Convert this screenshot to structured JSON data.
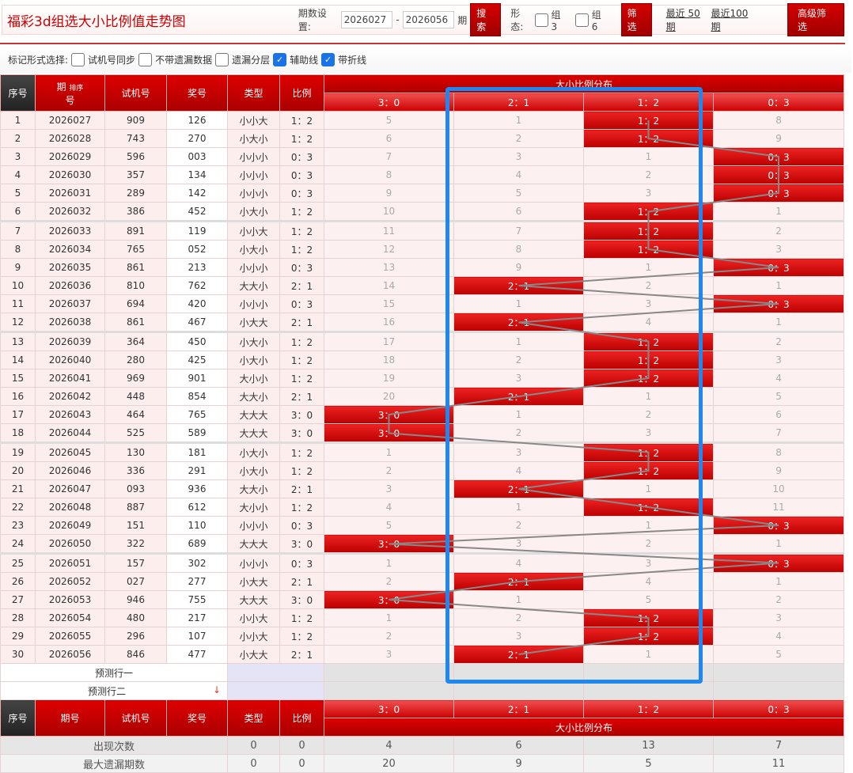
{
  "header": {
    "title": "福彩3d组选大小比例值走势图",
    "period_label": "期数设置:",
    "start": "2026027",
    "dash": "-",
    "end": "2026056",
    "period_suffix": "期",
    "search": "搜索",
    "form_label": "形态:",
    "group3": "组3",
    "group6": "组6",
    "filter": "筛选",
    "recent50": "最近 50期",
    "recent100": "最近100期",
    "advanced": "高级筛选"
  },
  "marks": {
    "label": "标记形式选择:",
    "options": [
      {
        "label": "试机号同步",
        "checked": false
      },
      {
        "label": "不带遗漏数据",
        "checked": false
      },
      {
        "label": "遗漏分层",
        "checked": false
      },
      {
        "label": "辅助线",
        "checked": true
      },
      {
        "label": "带折线",
        "checked": true
      }
    ]
  },
  "columns": {
    "seq": "序号",
    "period": "期号",
    "period_a": "期",
    "period_b": "号",
    "sort": "排序",
    "trial": "试机号",
    "draw": "奖号",
    "type": "类型",
    "ratio": "比例",
    "dist": "大小比例分布",
    "ratios": [
      "3：0",
      "2：1",
      "1：2",
      "0：3"
    ]
  },
  "rows": [
    [
      "1",
      "2026027",
      "909",
      "126",
      "小小大",
      "1：2",
      [
        5,
        1,
        "H",
        8
      ]
    ],
    [
      "2",
      "2026028",
      "743",
      "270",
      "小大小",
      "1：2",
      [
        6,
        2,
        "H",
        9
      ]
    ],
    [
      "3",
      "2026029",
      "596",
      "003",
      "小小小",
      "0：3",
      [
        7,
        3,
        1,
        "H"
      ]
    ],
    [
      "4",
      "2026030",
      "357",
      "134",
      "小小小",
      "0：3",
      [
        8,
        4,
        2,
        "H"
      ]
    ],
    [
      "5",
      "2026031",
      "289",
      "142",
      "小小小",
      "0：3",
      [
        9,
        5,
        3,
        "H"
      ]
    ],
    [
      "6",
      "2026032",
      "386",
      "452",
      "小大小",
      "1：2",
      [
        10,
        6,
        "H",
        1
      ]
    ],
    [
      "7",
      "2026033",
      "891",
      "119",
      "小小大",
      "1：2",
      [
        11,
        7,
        "H",
        2
      ]
    ],
    [
      "8",
      "2026034",
      "765",
      "052",
      "小大小",
      "1：2",
      [
        12,
        8,
        "H",
        3
      ]
    ],
    [
      "9",
      "2026035",
      "861",
      "213",
      "小小小",
      "0：3",
      [
        13,
        9,
        1,
        "H"
      ]
    ],
    [
      "10",
      "2026036",
      "810",
      "762",
      "大大小",
      "2：1",
      [
        14,
        "H",
        2,
        1
      ]
    ],
    [
      "11",
      "2026037",
      "694",
      "420",
      "小小小",
      "0：3",
      [
        15,
        1,
        3,
        "H"
      ]
    ],
    [
      "12",
      "2026038",
      "861",
      "467",
      "小大大",
      "2：1",
      [
        16,
        "H",
        4,
        1
      ]
    ],
    [
      "13",
      "2026039",
      "364",
      "450",
      "小大小",
      "1：2",
      [
        17,
        1,
        "H",
        2
      ]
    ],
    [
      "14",
      "2026040",
      "280",
      "425",
      "小大小",
      "1：2",
      [
        18,
        2,
        "H",
        3
      ]
    ],
    [
      "15",
      "2026041",
      "969",
      "901",
      "大小小",
      "1：2",
      [
        19,
        3,
        "H",
        4
      ]
    ],
    [
      "16",
      "2026042",
      "448",
      "854",
      "大大小",
      "2：1",
      [
        20,
        "H",
        1,
        5
      ]
    ],
    [
      "17",
      "2026043",
      "464",
      "765",
      "大大大",
      "3：0",
      [
        "H",
        1,
        2,
        6
      ]
    ],
    [
      "18",
      "2026044",
      "525",
      "589",
      "大大大",
      "3：0",
      [
        "H",
        2,
        3,
        7
      ]
    ],
    [
      "19",
      "2026045",
      "130",
      "181",
      "小大小",
      "1：2",
      [
        1,
        3,
        "H",
        8
      ]
    ],
    [
      "20",
      "2026046",
      "336",
      "291",
      "小大小",
      "1：2",
      [
        2,
        4,
        "H",
        9
      ]
    ],
    [
      "21",
      "2026047",
      "093",
      "936",
      "大大小",
      "2：1",
      [
        3,
        "H",
        1,
        10
      ]
    ],
    [
      "22",
      "2026048",
      "887",
      "612",
      "大小小",
      "1：2",
      [
        4,
        1,
        "H",
        11
      ]
    ],
    [
      "23",
      "2026049",
      "151",
      "110",
      "小小小",
      "0：3",
      [
        5,
        2,
        1,
        "H"
      ]
    ],
    [
      "24",
      "2026050",
      "322",
      "689",
      "大大大",
      "3：0",
      [
        "H",
        3,
        2,
        1
      ]
    ],
    [
      "25",
      "2026051",
      "157",
      "302",
      "小小小",
      "0：3",
      [
        1,
        4,
        3,
        "H"
      ]
    ],
    [
      "26",
      "2026052",
      "027",
      "277",
      "小大大",
      "2：1",
      [
        2,
        "H",
        4,
        1
      ]
    ],
    [
      "27",
      "2026053",
      "946",
      "755",
      "大大大",
      "3：0",
      [
        "H",
        1,
        5,
        2
      ]
    ],
    [
      "28",
      "2026054",
      "480",
      "217",
      "小小大",
      "1：2",
      [
        1,
        2,
        "H",
        3
      ]
    ],
    [
      "29",
      "2026055",
      "296",
      "107",
      "小小大",
      "1：2",
      [
        2,
        3,
        "H",
        4
      ]
    ],
    [
      "30",
      "2026056",
      "846",
      "477",
      "小大大",
      "2：1",
      [
        3,
        "H",
        1,
        5
      ]
    ]
  ],
  "predict": [
    "预测行一",
    "预测行二"
  ],
  "stats": [
    {
      "label": "出现次数",
      "type": "0",
      "ratio": "0",
      "values": [
        "4",
        "6",
        "13",
        "7"
      ]
    },
    {
      "label": "最大遗漏期数",
      "type": "0",
      "ratio": "0",
      "values": [
        "20",
        "9",
        "5",
        "11"
      ]
    }
  ],
  "colors": {
    "accent": "#cc0000",
    "highlight": "#1e88f0"
  }
}
